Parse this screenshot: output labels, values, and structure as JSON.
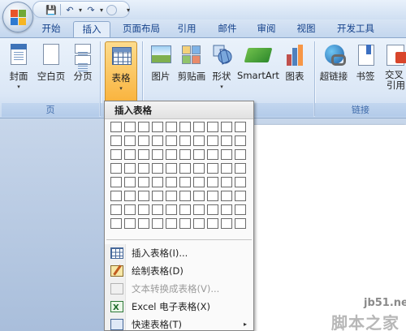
{
  "qat": {
    "save": "💾",
    "undo": "↶",
    "redo": "↷",
    "more": "▾"
  },
  "tabs": [
    "开始",
    "插入",
    "页面布局",
    "引用",
    "邮件",
    "审阅",
    "视图",
    "开发工具"
  ],
  "active_tab": "插入",
  "ribbon": {
    "pages_group": {
      "label": "页",
      "buttons": [
        "封面",
        "空白页",
        "分页"
      ]
    },
    "table_group": {
      "buttons": [
        "表格"
      ]
    },
    "illustrations_group": {
      "buttons": [
        "图片",
        "剪贴画",
        "形状",
        "SmartArt",
        "图表"
      ]
    },
    "links_group": {
      "label": "链接",
      "buttons": [
        "超链接",
        "书签",
        "交叉",
        "引用"
      ]
    }
  },
  "dropdown": {
    "title": "插入表格",
    "grid": {
      "cols": 10,
      "rows": 8
    },
    "items": [
      {
        "label": "插入表格(I)...",
        "enabled": true,
        "icon": "insert-table-icon"
      },
      {
        "label": "绘制表格(D)",
        "enabled": true,
        "icon": "draw-table-icon"
      },
      {
        "label": "文本转换成表格(V)...",
        "enabled": false,
        "icon": "text-to-table-icon"
      },
      {
        "label": "Excel 电子表格(X)",
        "enabled": true,
        "icon": "excel-spreadsheet-icon"
      },
      {
        "label": "快速表格(T)",
        "enabled": true,
        "icon": "quick-tables-icon",
        "submenu": "▸"
      }
    ]
  },
  "watermark": {
    "site": "jb51.net",
    "brand": "脚本之家"
  }
}
